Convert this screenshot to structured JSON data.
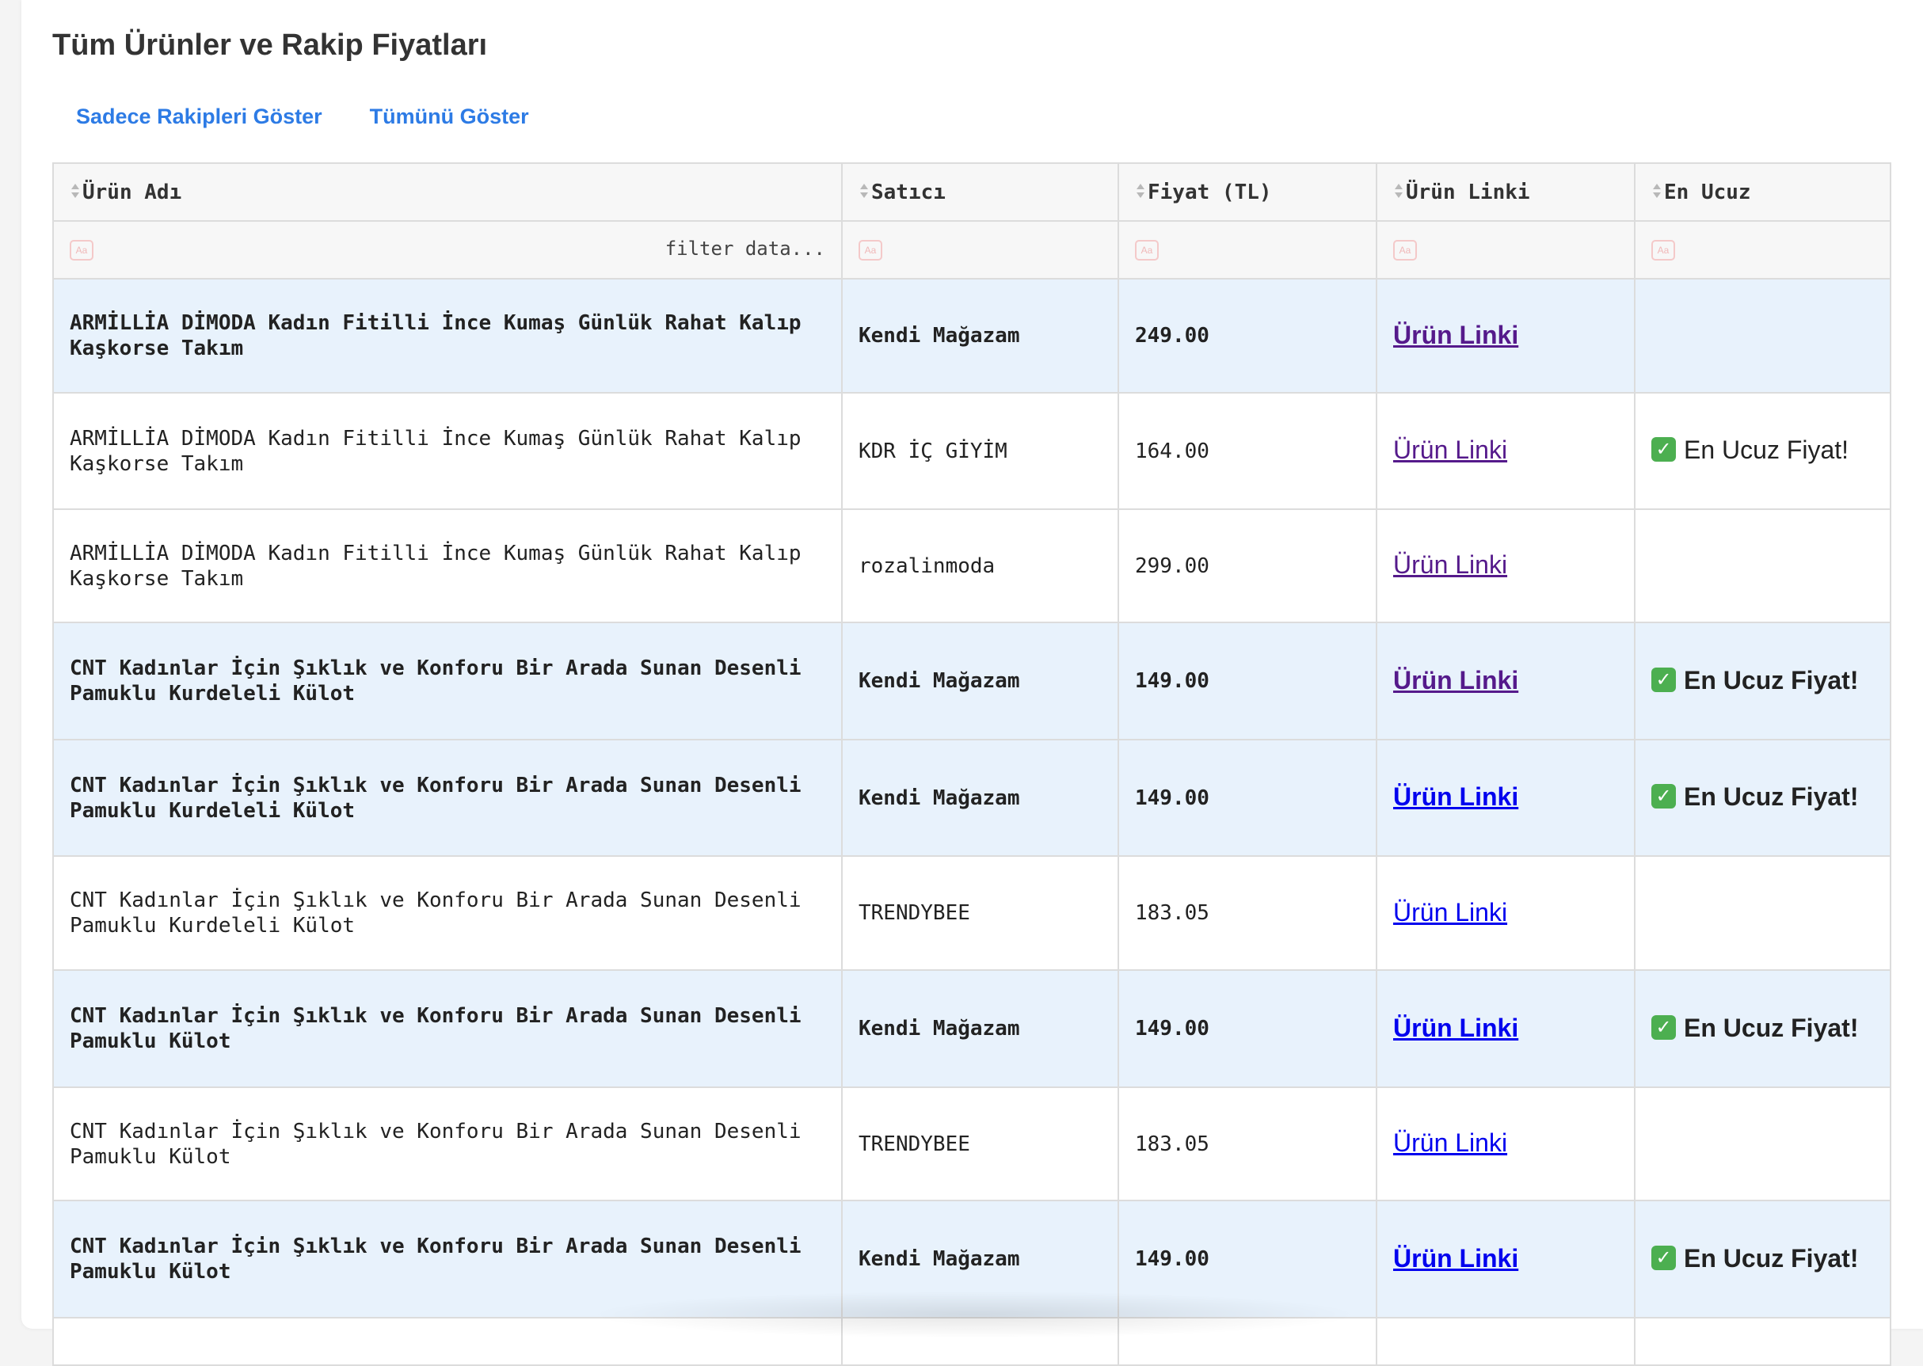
{
  "page": {
    "title": "Tüm Ürünler ve Rakip Fiyatları"
  },
  "filters": {
    "rivals_only_label": "Sadece Rakipleri Göster",
    "show_all_label": "Tümünü Göster"
  },
  "table": {
    "columns": [
      {
        "label": "Ürün Adı",
        "icon": "sort-icon"
      },
      {
        "label": "Satıcı",
        "icon": "sort-icon"
      },
      {
        "label": "Fiyat (TL)",
        "icon": "sort-icon"
      },
      {
        "label": "Ürün Linki",
        "icon": "sort-icon"
      },
      {
        "label": "En Ucuz",
        "icon": "sort-icon"
      }
    ],
    "filter_placeholder": "filter data...",
    "filter_icon_text": "Aa",
    "rows": [
      {
        "product": "ARMİLLİA DİMODA Kadın Fitilli İnce Kumaş Günlük Rahat Kalıp Kaşkorse Takım",
        "seller": "Kendi Mağazam",
        "price": "249.00",
        "link": "Ürün Linki",
        "cheapest": ""
      },
      {
        "product": "ARMİLLİA DİMODA Kadın Fitilli İnce Kumaş Günlük Rahat Kalıp Kaşkorse Takım",
        "seller": "KDR İÇ GİYİM",
        "price": "164.00",
        "link": "Ürün Linki",
        "cheapest": "En Ucuz Fiyat!"
      },
      {
        "product": "ARMİLLİA DİMODA Kadın Fitilli İnce Kumaş Günlük Rahat Kalıp Kaşkorse Takım",
        "seller": "rozalinmoda",
        "price": "299.00",
        "link": "Ürün Linki",
        "cheapest": ""
      },
      {
        "product": "CNT Kadınlar İçin Şıklık ve Konforu Bir Arada Sunan Desenli Pamuklu Kurdeleli Külot",
        "seller": "Kendi Mağazam",
        "price": "149.00",
        "link": "Ürün Linki",
        "cheapest": "En Ucuz Fiyat!"
      },
      {
        "product": "CNT Kadınlar İçin Şıklık ve Konforu Bir Arada Sunan Desenli Pamuklu Kurdeleli Külot",
        "seller": "Kendi Mağazam",
        "price": "149.00",
        "link": "Ürün Linki",
        "cheapest": "En Ucuz Fiyat!"
      },
      {
        "product": "CNT Kadınlar İçin Şıklık ve Konforu Bir Arada Sunan Desenli Pamuklu Kurdeleli Külot",
        "seller": "TRENDYBEE",
        "price": "183.05",
        "link": "Ürün Linki",
        "cheapest": ""
      },
      {
        "product": "CNT Kadınlar İçin Şıklık ve Konforu Bir Arada Sunan Desenli Pamuklu Külot",
        "seller": "Kendi Mağazam",
        "price": "149.00",
        "link": "Ürün Linki",
        "cheapest": "En Ucuz Fiyat!"
      },
      {
        "product": "CNT Kadınlar İçin Şıklık ve Konforu Bir Arada Sunan Desenli Pamuklu Külot",
        "seller": "TRENDYBEE",
        "price": "183.05",
        "link": "Ürün Linki",
        "cheapest": ""
      },
      {
        "product": "CNT Kadınlar İçin Şıklık ve Konforu Bir Arada Sunan Desenli Pamuklu Külot",
        "seller": "Kendi Mağazam",
        "price": "149.00",
        "link": "Ürün Linki",
        "cheapest": "En Ucuz Fiyat!"
      }
    ]
  },
  "colors": {
    "own_row_background": "#e8f2fc",
    "filter_link": "#2d7be5",
    "visited_link": "#551a8b",
    "unvisited_link": "#0000ee",
    "check_badge": "#4caf50"
  }
}
